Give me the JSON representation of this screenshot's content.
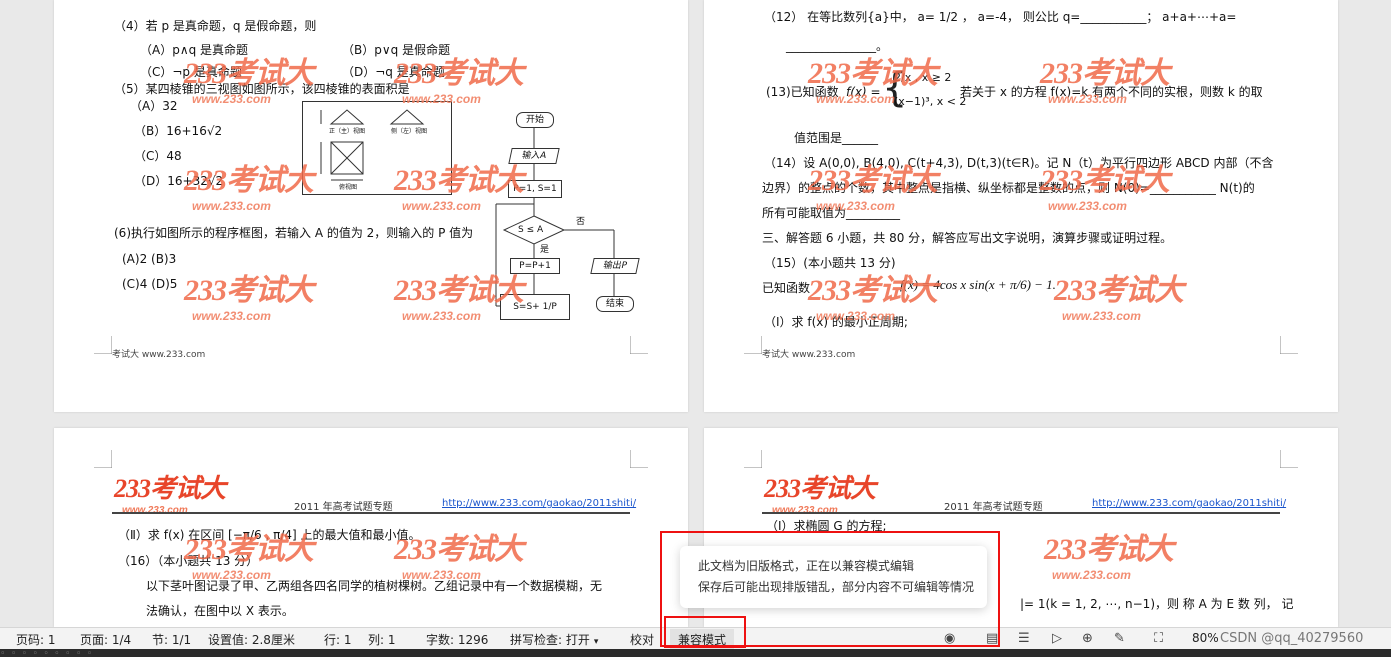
{
  "p1": {
    "q4": "（4）若 p 是真命题，q 是假命题，则",
    "q4a": "（A）p∧q 是真命题",
    "q4b": "（B）p∨q 是假命题",
    "q4c": "（C）¬p 是真命题",
    "q4d": "（D）¬q 是真命题",
    "q5": "（5）某四棱锥的三视图如图所示，该四棱锥的表面积是",
    "q5a": "（A）32",
    "q5b": "（B）16+16√2",
    "q5c": "（C）48",
    "q5d": "（D）16+32√2",
    "q6": "(6)执行如图所示的程序框图，若输入 A 的值为 2，则输入的 P 值为",
    "q6ab": "(A)2 (B)3",
    "q6cd": "(C)4 (D)5",
    "fig_front": "正（主）视图",
    "fig_side": "侧（左）视图",
    "fig_top": "俯视图",
    "flow": {
      "start": "开始",
      "input": "输入A",
      "init": "P=1, S=1",
      "cond": "S ≤ A",
      "no": "否",
      "yes": "是",
      "step1": "P=P+1",
      "step2": "S=S+ 1/P",
      "output": "输出P",
      "end": "结束"
    },
    "footer": "考试大 www.233.com"
  },
  "p2": {
    "q12a": "（12） 在等比数列{a}中， a= 1/2 ， a=-4， 则公比 q=___________； a+a+⋯+a=",
    "q12b": "_______________。",
    "q13pre": "(13)已知函数",
    "q13fa": "2/x ,  x ≥ 2",
    "q13fb": "(x−1)³, x < 2",
    "q13post": "若关于 x 的方程 f(x)=k 有两个不同的实根，则数 k 的取",
    "q13end": "值范围是______",
    "q14a": "（14）设 A(0,0), B(4,0), C(t+4,3), D(t,3)(t∈R)。记 N（t）为平行四边形 ABCD 内部（不含",
    "q14b": "边界）的整点的个数，其中整点是指横、纵坐标都是整数的点，则 N(0)=___________ N(t)的",
    "q14c": "所有可能取值为_________",
    "sec3": "三、解答题 6 小题，共 80 分，解答应写出文字说明，演算步骤或证明过程。",
    "q15": "（15）(本小题共 13 分)",
    "q15func_label": "已知函数",
    "q15func": "f(x) = 4cos x sin(x + π/6) − 1.",
    "q15i": "（Ⅰ）求 f(x) 的最小正周期;",
    "footer": "考试大 www.233.com"
  },
  "p3": {
    "hdr_title": "2011 年高考试题专题",
    "hdr_link": "http://www.233.com/gaokao/2011shiti/",
    "q15ii": "（Ⅱ）求 f(x) 在区间 [−π/6 , π/4] 上的最大值和最小值。",
    "q16": "（16）（本小题共 13 分）",
    "q16a": "以下茎叶图记录了甲、乙两组各四名同学的植树棵树。乙组记录中有一个数据模糊，无",
    "q16b": "法确认，在图中以 X 表示。"
  },
  "p4": {
    "hdr_title": "2011 年高考试题专题",
    "hdr_link": "http://www.233.com/gaokao/2011shiti/",
    "q_i": "（Ⅰ）求椭圆 G 的方程;",
    "q_tail": "|= 1(k = 1, 2, ⋯, n−1)，则 称 A 为 E 数 列， 记"
  },
  "watermark": {
    "logo": "233考试大",
    "url": "www.233.com"
  },
  "tooltip": {
    "line1": "此文档为旧版格式，正在以兼容模式编辑",
    "line2": "保存后可能出现排版错乱，部分内容不可编辑等情况"
  },
  "status": {
    "page": "页码: 1",
    "pages": "页面: 1/4",
    "section": "节: 1/1",
    "setting": "设置值: 2.8厘米",
    "row": "行: 1",
    "col": "列: 1",
    "words": "字数: 1296",
    "spell": "拼写检查: 打开",
    "proof": "校对",
    "compat": "兼容模式",
    "zoom": "80%",
    "credit": "CSDN @qq_40279560"
  },
  "console": "  ◦ ◦ ◦ ◦ ◦ ◦ ◦ ◦ ◦"
}
